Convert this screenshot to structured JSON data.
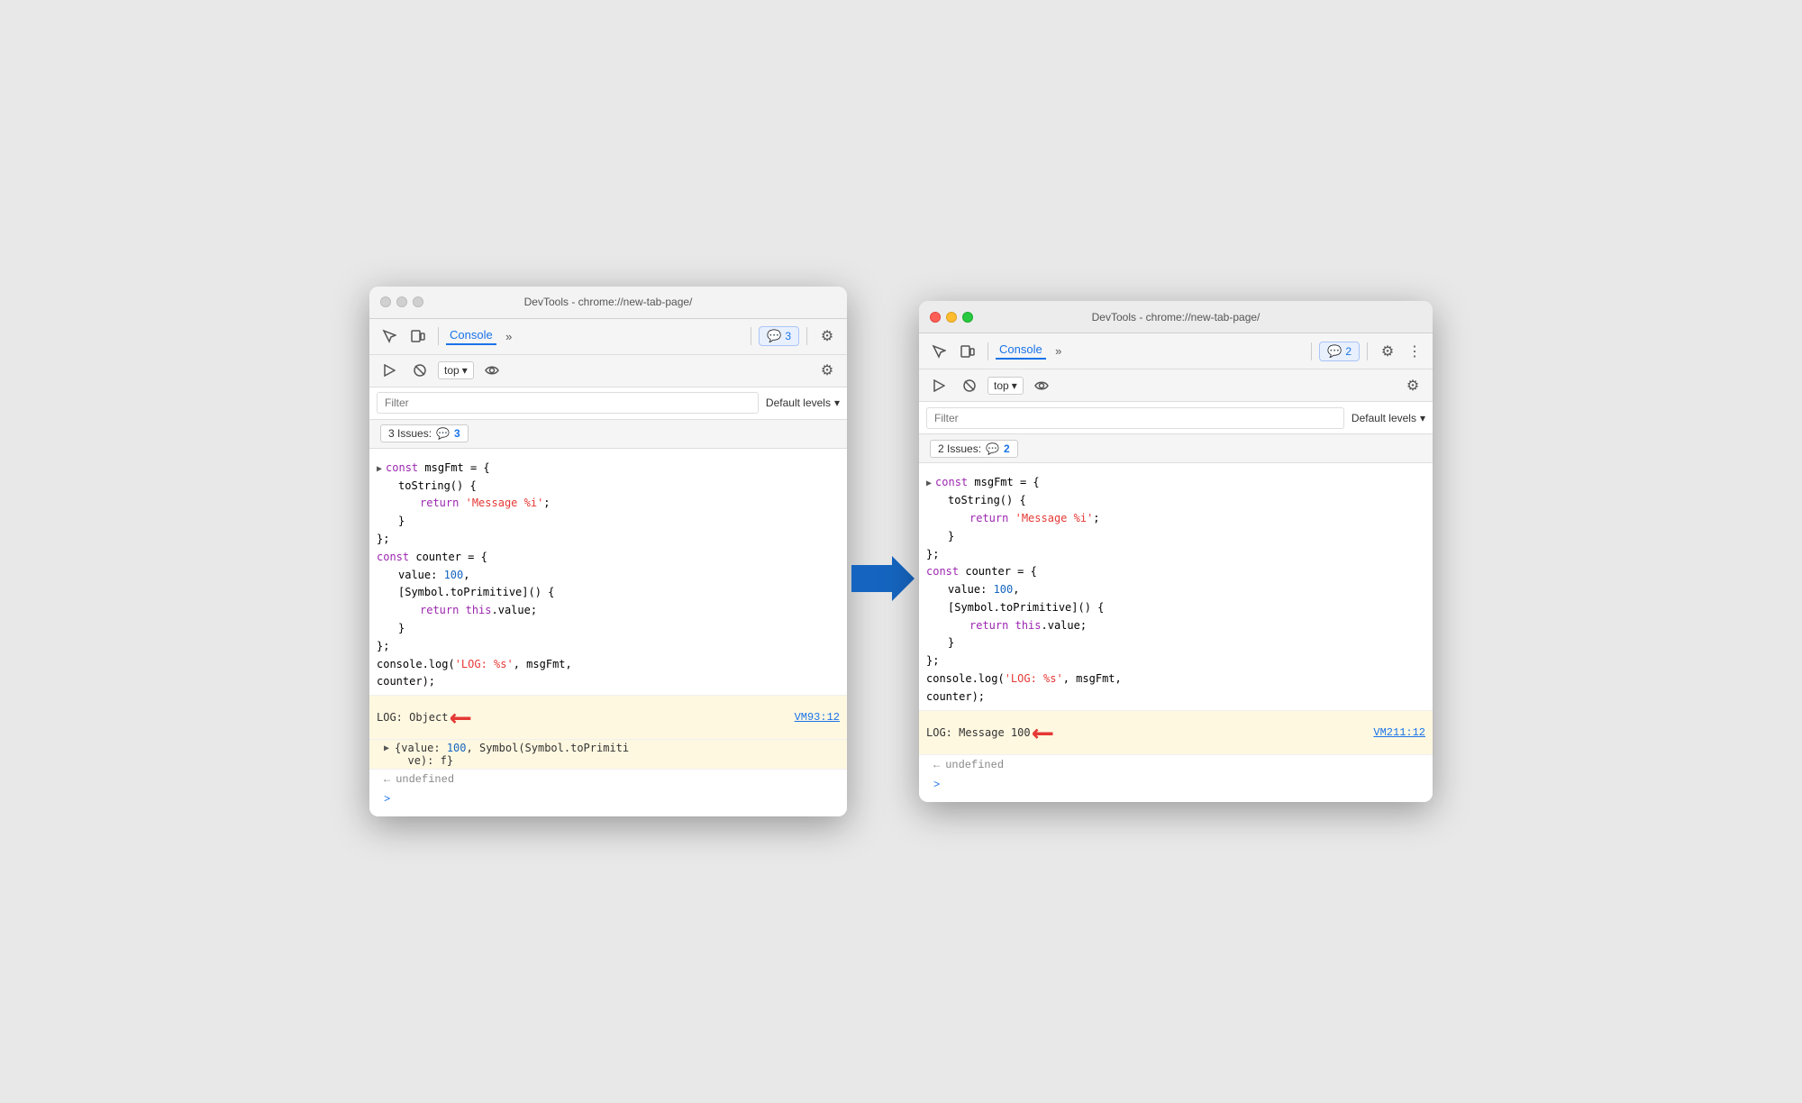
{
  "left_window": {
    "title": "DevTools - chrome://new-tab-page/",
    "tab_label": "Console",
    "badge_count": "3",
    "top_selector": "top",
    "filter_placeholder": "Filter",
    "default_levels": "Default levels",
    "issues_label": "3 Issues:",
    "issues_count": "3",
    "code": [
      {
        "type": "expand",
        "content": "const msgFmt = {"
      },
      {
        "type": "indent1",
        "content": "toString() {"
      },
      {
        "type": "indent2_str",
        "content": "return 'Message %i';"
      },
      {
        "type": "indent1",
        "content": "}"
      },
      {
        "type": "root",
        "content": "};"
      },
      {
        "type": "expand2",
        "content": "const counter = {"
      },
      {
        "type": "indent1",
        "content": "value: 100,"
      },
      {
        "type": "indent1",
        "content": "[Symbol.toPrimitive]() {"
      },
      {
        "type": "indent2_str",
        "content": "return this.value;"
      },
      {
        "type": "indent1",
        "content": "}"
      },
      {
        "type": "root",
        "content": "};"
      },
      {
        "type": "root",
        "content": "console.log('LOG: %s', msgFmt,"
      },
      {
        "type": "root",
        "content": "counter);"
      }
    ],
    "log_output": "LOG: Object",
    "log_detail": "{value: 100, Symbol(Symbol.toPrimiti\nve): f}",
    "vm_link": "VM93:12",
    "undefined_text": "undefined",
    "prompt": ">"
  },
  "right_window": {
    "title": "DevTools - chrome://new-tab-page/",
    "tab_label": "Console",
    "badge_count": "2",
    "top_selector": "top",
    "filter_placeholder": "Filter",
    "default_levels": "Default levels",
    "issues_label": "2 Issues:",
    "issues_count": "2",
    "code": [
      {
        "type": "expand",
        "content": "const msgFmt = {"
      },
      {
        "type": "indent1",
        "content": "toString() {"
      },
      {
        "type": "indent2_str",
        "content": "return 'Message %i';"
      },
      {
        "type": "indent1",
        "content": "}"
      },
      {
        "type": "root",
        "content": "};"
      },
      {
        "type": "expand2",
        "content": "const counter = {"
      },
      {
        "type": "indent1",
        "content": "value: 100,"
      },
      {
        "type": "indent1",
        "content": "[Symbol.toPrimitive]() {"
      },
      {
        "type": "indent2_str",
        "content": "return this.value;"
      },
      {
        "type": "indent1",
        "content": "}"
      },
      {
        "type": "root",
        "content": "};"
      },
      {
        "type": "root",
        "content": "console.log('LOG: %s', msgFmt,"
      },
      {
        "type": "root",
        "content": "counter);"
      }
    ],
    "log_output": "LOG: Message 100",
    "vm_link": "VM211:12",
    "undefined_text": "undefined",
    "prompt": ">"
  },
  "arrow": {
    "direction": "right",
    "color": "#1565c0"
  }
}
